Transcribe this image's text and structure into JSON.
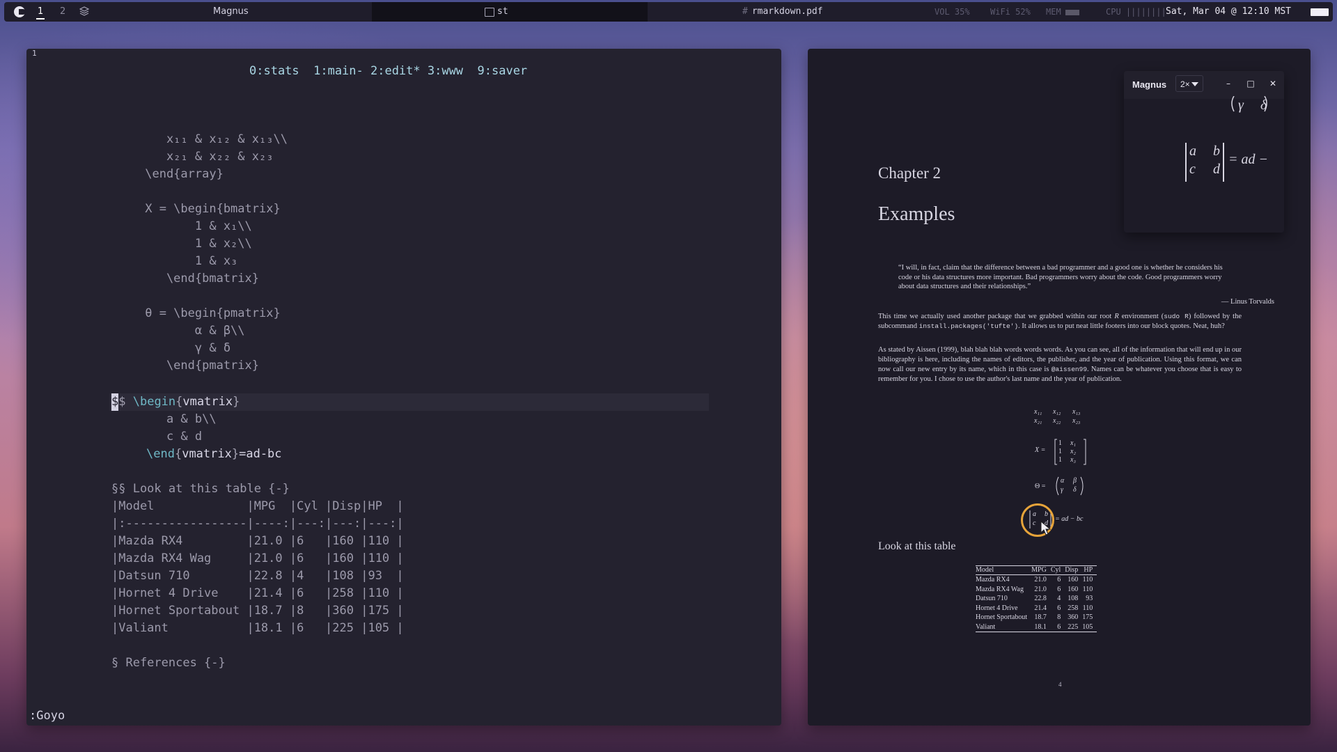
{
  "topbar": {
    "workspaces": [
      "1",
      "2"
    ],
    "window_title": "Magnus",
    "terminal_tab": "st",
    "pdf_hash": "#",
    "pdf_tab": "rmarkdown.pdf",
    "vol": "VOL 35%",
    "wifi": "WiFi 52%",
    "mem": "MEM",
    "cpu": "CPU ||||||||",
    "datetime": "Sat, Mar 04 @ 12:10 MST"
  },
  "editor": {
    "line_number": "1",
    "tmux_status": "0:stats  1:main- 2:edit* 3:www  9:saver",
    "lines": [
      "    x₁₁ & x₁₂ & x₁₃\\\\",
      "    x₂₁ & x₂₂ & x₂₃",
      " \\end{array}",
      "",
      " X = \\begin{bmatrix}",
      "        1 & x₁\\\\",
      "        1 & x₂\\\\",
      "        1 & x₃",
      "    \\end{bmatrix}",
      "",
      " θ = \\begin{pmatrix}",
      "        α & β\\\\",
      "        γ & δ",
      "    \\end{pmatrix}"
    ],
    "cursor_char": "$",
    "cursor_line_rest": "$ ",
    "vm_kw1": "\\begin",
    "vm_env1": "vmatrix",
    "vm_row1": "    a & b\\\\",
    "vm_row2": "    c & d",
    "vm_kw2": "\\end",
    "vm_env2": "vmatrix",
    "vm_tail": "=ad-bc",
    "table_heading": "§§ Look at this table {-}",
    "table_lines": [
      "|Model             |MPG  |Cyl |Disp|HP  |",
      "|:-----------------|----:|---:|---:|---:|",
      "|Mazda RX4         |21.0 |6   |160 |110 |",
      "|Mazda RX4 Wag     |21.0 |6   |160 |110 |",
      "|Datsun 710        |22.8 |4   |108 |93  |",
      "|Hornet 4 Drive    |21.4 |6   |258 |110 |",
      "|Hornet Sportabout |18.7 |8   |360 |175 |",
      "|Valiant           |18.1 |6   |225 |105 |"
    ],
    "references": "§ References {-}",
    "command": ":Goyo"
  },
  "pdf": {
    "chapter": "Chapter 2",
    "title": "Examples",
    "quote": "“I will, in fact, claim that the difference between a bad programmer and a good one is whether he considers his code or his data structures more important. Bad programmers worry about the code. Good programmers worry about data structures and their relationships.”",
    "quote_attr": "— Linus Torvalds",
    "p1_a": "This time we actually used another package that we grabbed within our root ",
    "p1_r": "R",
    "p1_b": " environment (",
    "p1_code1": "sudo R",
    "p1_c": ") followed by the subcommand ",
    "p1_code2": "install.packages('tufte')",
    "p1_d": ". It allows us to put neat little footers into our block quotes. Neat, huh?",
    "p2_a": "As stated by Aissen (1999), blah blah blah words words words. As you can see, all of the information that will end up in our bibliography is here, including the names of editors, the publisher, and the year of publication. Using this format, we can now call our new entry by its name, which in this case is ",
    "p2_code": "@aissen99",
    "p2_b": ". Names can be whatever you choose that is easy to remember for you. I chose to use the author's last name and the year of publication.",
    "arr_row1": [
      "x₁₁",
      "x₁₂",
      "x₁₃"
    ],
    "arr_row2": [
      "x₂₁",
      "x₂₂",
      "x₂₃"
    ],
    "bm_lhs": "X =",
    "bm_col1": [
      "1",
      "1",
      "1"
    ],
    "bm_col2": [
      "x₁",
      "x₂",
      "x₃"
    ],
    "pm_lhs": "Θ =",
    "pm_r1": [
      "α",
      "β"
    ],
    "pm_r2": [
      "γ",
      "δ"
    ],
    "vm_r1": [
      "a",
      "b"
    ],
    "vm_r2": [
      "c",
      "d"
    ],
    "vm_rhs": "= ad − bc",
    "table_title": "Look at this table",
    "table_headers": [
      "Model",
      "MPG",
      "Cyl",
      "Disp",
      "HP"
    ],
    "table_rows": [
      [
        "Mazda RX4",
        "21.0",
        "6",
        "160",
        "110"
      ],
      [
        "Mazda RX4 Wag",
        "21.0",
        "6",
        "160",
        "110"
      ],
      [
        "Datsun 710",
        "22.8",
        "4",
        "108",
        "93"
      ],
      [
        "Hornet 4 Drive",
        "21.4",
        "6",
        "258",
        "110"
      ],
      [
        "Hornet Sportabout",
        "18.7",
        "8",
        "360",
        "175"
      ],
      [
        "Valiant",
        "18.1",
        "6",
        "225",
        "105"
      ]
    ],
    "page_number": "4"
  },
  "magnifier": {
    "title": "Magnus",
    "zoom": "2×",
    "content_top_row": [
      "γ",
      "δ"
    ],
    "content_r1": [
      "a",
      "b"
    ],
    "content_r2": [
      "c",
      "d"
    ],
    "content_rhs": "= ad −",
    "minimize": "–",
    "maximize": "□",
    "close": "✕"
  },
  "colors": {
    "accent_ring": "#e7a43a",
    "keyword": "#6fb8c6",
    "tmux": "#a9d6e4"
  }
}
